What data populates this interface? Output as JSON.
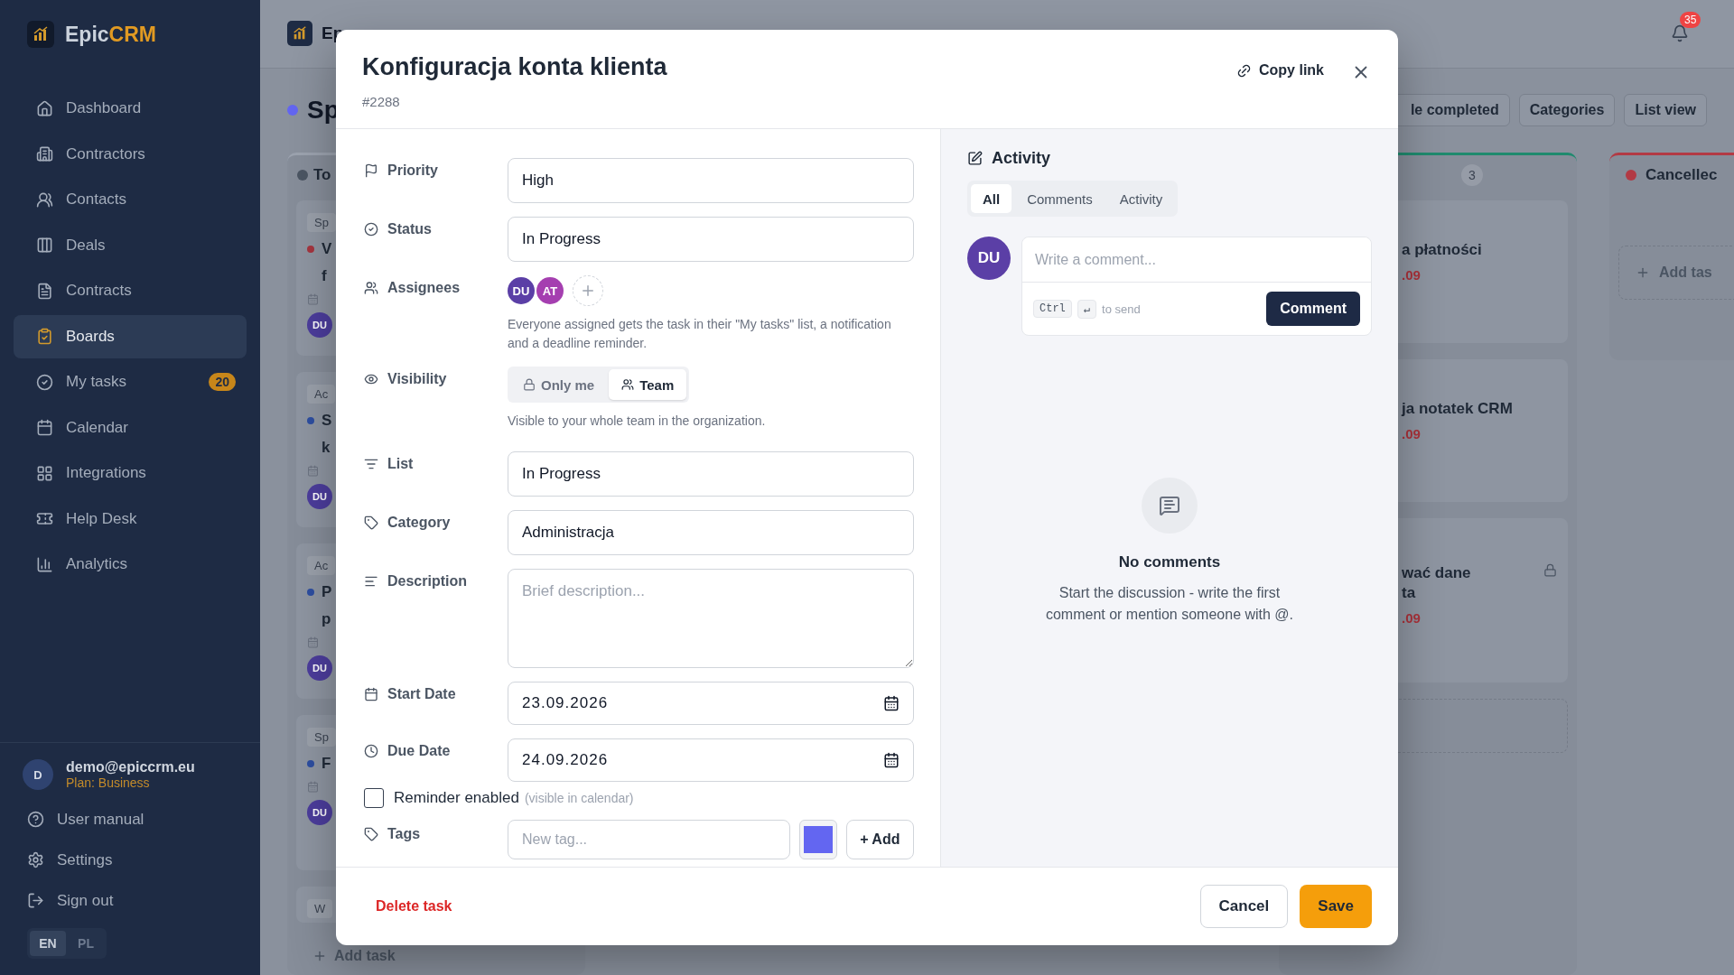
{
  "sidebar": {
    "brand": {
      "name": "Epic",
      "accent": "CRM"
    },
    "nav": [
      {
        "label": "Dashboard",
        "selected": false
      },
      {
        "label": "Contractors",
        "selected": false
      },
      {
        "label": "Contacts",
        "selected": false
      },
      {
        "label": "Deals",
        "selected": false
      },
      {
        "label": "Contracts",
        "selected": false
      },
      {
        "label": "Boards",
        "selected": true
      },
      {
        "label": "My tasks",
        "selected": false,
        "badge": "20"
      },
      {
        "label": "Calendar",
        "selected": false
      },
      {
        "label": "Integrations",
        "selected": false
      },
      {
        "label": "Help Desk",
        "selected": false
      },
      {
        "label": "Analytics",
        "selected": false
      }
    ],
    "user": {
      "initial": "D",
      "email": "demo@epiccrm.eu",
      "plan": "Plan: Business"
    },
    "links": [
      "User manual",
      "Settings",
      "Sign out"
    ],
    "languages": [
      {
        "label": "EN",
        "selected": true
      },
      {
        "label": "PL",
        "selected": false
      }
    ]
  },
  "header": {
    "brand_fragment": "Ep",
    "notification_count": "35"
  },
  "board": {
    "title_fragment": "Sp",
    "toolbar": [
      "le completed",
      "Categories",
      "List view"
    ],
    "left_column": {
      "title_fragment": "To",
      "add_task": "Add task",
      "cards": [
        {
          "tag": "Sp",
          "color": "#a5353f",
          "lines": [
            "V",
            "f"
          ],
          "avatar": "DU"
        },
        {
          "tag": "Ac",
          "color": "#2d4ea0",
          "lines": [
            "S",
            "k"
          ],
          "avatar": "DU"
        },
        {
          "tag": "Ac",
          "color": "#2d4ea0",
          "lines": [
            "P",
            "p"
          ],
          "avatar": "DU"
        },
        {
          "tag": "Sp",
          "color": "#2d4ea0",
          "lines": [
            "F"
          ],
          "avatar": "DU"
        },
        {
          "tag": "W"
        }
      ]
    },
    "right_columns": [
      {
        "kind": "cards",
        "count": "3",
        "color": "#1f8a6e",
        "cards": [
          {
            "lines": [
              "a płatności"
            ],
            "date": ".09",
            "locked": false
          },
          {
            "lines": [
              "ja notatek CRM"
            ],
            "date": ".09",
            "locked": false
          },
          {
            "lines": [
              "wać dane",
              "ta"
            ],
            "date": ".09",
            "locked": true
          }
        ]
      },
      {
        "kind": "empty",
        "title_fragment": "Cancellec",
        "color": "#b23a44",
        "add_task": "Add tas"
      }
    ]
  },
  "modal": {
    "title": "Konfiguracja konta klienta",
    "id": "#2288",
    "copy_link": "Copy link",
    "fields": {
      "priority": {
        "label": "Priority",
        "value": "High"
      },
      "status": {
        "label": "Status",
        "value": "In Progress"
      },
      "assignees": {
        "label": "Assignees",
        "avatars": [
          {
            "initials": "DU",
            "color": "#5b3fa6"
          },
          {
            "initials": "AT",
            "color": "#a53fb0"
          }
        ],
        "help": "Everyone assigned gets the task in their \"My tasks\" list, a notification and a deadline reminder."
      },
      "visibility": {
        "label": "Visibility",
        "options": [
          {
            "label": "Only me",
            "selected": false
          },
          {
            "label": "Team",
            "selected": true
          }
        ],
        "help": "Visible to your whole team in the organization."
      },
      "list": {
        "label": "List",
        "value": "In Progress"
      },
      "category": {
        "label": "Category",
        "value": "Administracja"
      },
      "description": {
        "label": "Description",
        "placeholder": "Brief description..."
      },
      "start_date": {
        "label": "Start Date",
        "value": "23.09.2026"
      },
      "due_date": {
        "label": "Due Date",
        "value": "24.09.2026"
      },
      "reminder": {
        "label": "Reminder enabled",
        "hint": "(visible in calendar)",
        "checked": false
      },
      "tags": {
        "label": "Tags",
        "placeholder": "New tag...",
        "color": "#6366f1",
        "add": "+ Add"
      }
    },
    "activity": {
      "title": "Activity",
      "tabs": [
        {
          "label": "All",
          "selected": true
        },
        {
          "label": "Comments",
          "selected": false
        },
        {
          "label": "Activity",
          "selected": false
        }
      ],
      "avatar": "DU",
      "comment_placeholder": "Write a comment...",
      "keys": [
        "Ctrl",
        "↵"
      ],
      "send_hint": "to send",
      "comment_button": "Comment",
      "empty_title": "No comments",
      "empty_text": "Start the discussion - write the first comment or mention someone with @."
    },
    "footer": {
      "delete": "Delete task",
      "cancel": "Cancel",
      "save": "Save"
    }
  }
}
